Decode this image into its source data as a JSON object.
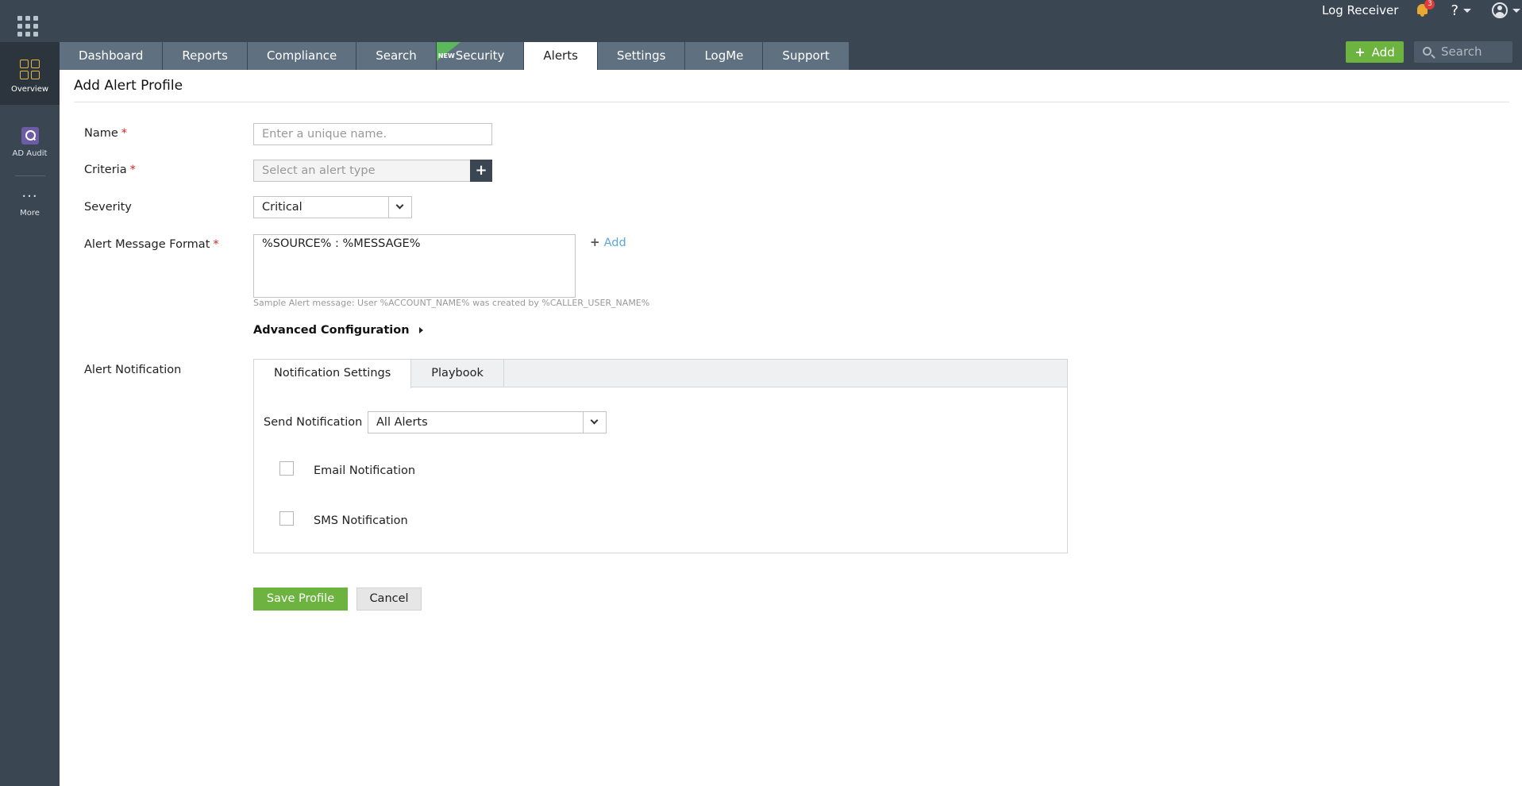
{
  "sidebar": {
    "items": [
      {
        "label": "Overview",
        "icon": "overview-grid-icon"
      },
      {
        "label": "AD Audit",
        "icon": "ad-audit-icon"
      },
      {
        "label": "More",
        "icon": "more-dots-icon"
      }
    ]
  },
  "header": {
    "log_receiver": "Log Receiver",
    "notification_count": "3",
    "help_label": "?",
    "add_label": "Add",
    "search_placeholder": "Search",
    "new_badge": "NEW"
  },
  "tabs": [
    {
      "label": "Dashboard"
    },
    {
      "label": "Reports"
    },
    {
      "label": "Compliance"
    },
    {
      "label": "Search"
    },
    {
      "label": "Security"
    },
    {
      "label": "Alerts"
    },
    {
      "label": "Settings"
    },
    {
      "label": "LogMe"
    },
    {
      "label": "Support"
    }
  ],
  "active_tab": "Alerts",
  "form": {
    "title": "Add Alert Profile",
    "required_mark": "*",
    "name_label": "Name",
    "name_placeholder": "Enter a unique name.",
    "criteria_label": "Criteria",
    "criteria_placeholder": "Select an alert type",
    "criteria_add": "+",
    "severity_label": "Severity",
    "severity_value": "Critical",
    "message_label": "Alert Message Format",
    "message_value": "%SOURCE% : %MESSAGE%",
    "message_add": "Add",
    "sample_hint": "Sample Alert message: User %ACCOUNT_NAME% was created by %CALLER_USER_NAME%",
    "advanced_label": "Advanced Configuration",
    "notification_label": "Alert Notification"
  },
  "notification": {
    "tabs": [
      {
        "label": "Notification Settings"
      },
      {
        "label": "Playbook"
      }
    ],
    "send_label": "Send Notification",
    "send_value": "All Alerts",
    "options": [
      {
        "label": "Email Notification",
        "checked": false
      },
      {
        "label": "SMS Notification",
        "checked": false
      }
    ]
  },
  "actions": {
    "save": "Save Profile",
    "cancel": "Cancel"
  },
  "colors": {
    "header_bg": "#3a4651",
    "tab_bg": "#5f7180",
    "accent_green": "#6cb33f",
    "link_blue": "#5aa9d4",
    "required_red": "#e02020",
    "bell": "#e8a933"
  }
}
